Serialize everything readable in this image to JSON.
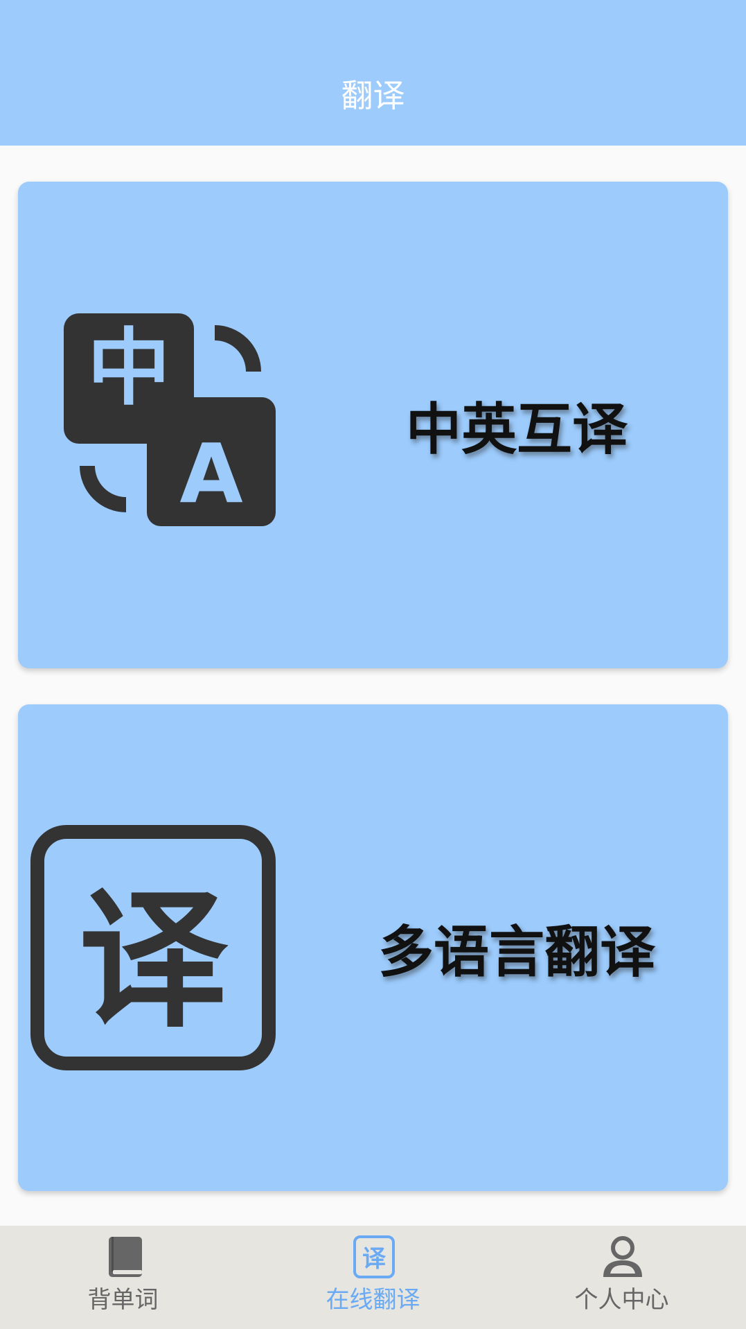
{
  "header": {
    "title": "翻译"
  },
  "cards": [
    {
      "label": "中英互译",
      "icon": "translate-zh-en-icon",
      "icon_glyph_zh": "中",
      "icon_glyph_en": "A"
    },
    {
      "label": "多语言翻译",
      "icon": "translate-box-icon",
      "icon_glyph": "译"
    }
  ],
  "tabbar": {
    "tabs": [
      {
        "label": "背单词",
        "icon": "book-icon",
        "active": false
      },
      {
        "label": "在线翻译",
        "icon": "translate-tab-icon",
        "icon_glyph": "译",
        "active": true
      },
      {
        "label": "个人中心",
        "icon": "person-icon",
        "active": false
      }
    ]
  },
  "colors": {
    "primary": "#9ccbfc",
    "icon_dark": "#333333",
    "active_tab": "#6aaaf4",
    "inactive_tab": "#666666",
    "tabbar_bg": "#e6e5e0",
    "page_bg": "#fafafa"
  }
}
